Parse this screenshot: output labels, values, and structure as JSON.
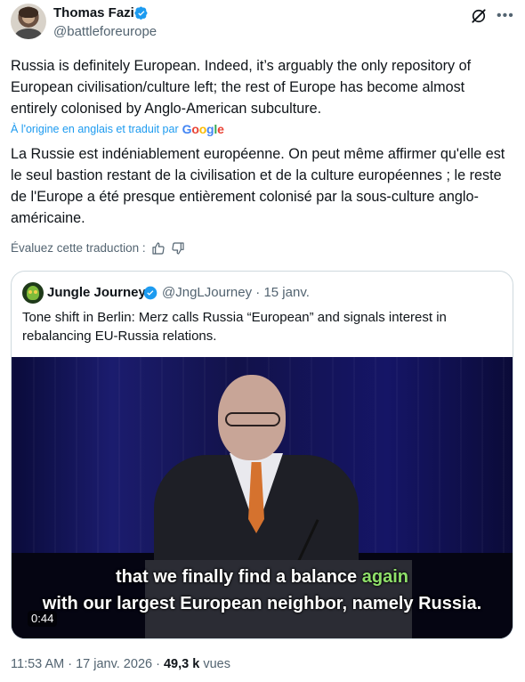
{
  "author": {
    "name": "Thomas Fazi",
    "handle": "@battleforeurope",
    "avatar_icon": "user-avatar"
  },
  "header_icons": {
    "grok": "grok-icon",
    "more": "more-icon"
  },
  "tweet": {
    "text": "Russia is definitely European. Indeed, it’s arguably the only repository of European civilisation/culture left; the rest of Europe has become almost entirely colonised by Anglo-American subculture.",
    "translation_note": "À l'origine en anglais et traduit par",
    "translation_provider": "Google",
    "translated_text": "La Russie est indéniablement européenne. On peut même affirmer qu'elle est le seul bastion restant de la civilisation et de la culture européennes ; le reste de l'Europe a été presque entièrement colonisé par la sous-culture anglo-américaine.",
    "rate_label": "Évaluez cette traduction :"
  },
  "quote": {
    "name": "Jungle Journey",
    "handle_date": "@JngLJourney · 15 janv.",
    "text": "Tone shift in Berlin: Merz calls Russia “European” and signals interest in rebalancing EU-Russia relations.",
    "video": {
      "subtitle_line1_a": "that we finally find a balance",
      "subtitle_line1_b": "again",
      "subtitle_line2": "with our largest European neighbor, namely Russia.",
      "duration": "0:44"
    }
  },
  "meta": {
    "timestamp": "11:53 AM · 17 janv. 2026 ·",
    "views_count": "49,3 k",
    "views_label": "vues"
  },
  "colors": {
    "text": "#0f1419",
    "secondary": "#536471",
    "link": "#1d9bf0",
    "verified": "#1d9bf0",
    "border": "#cfd9de",
    "subtitle_highlight": "#8fe06a"
  }
}
